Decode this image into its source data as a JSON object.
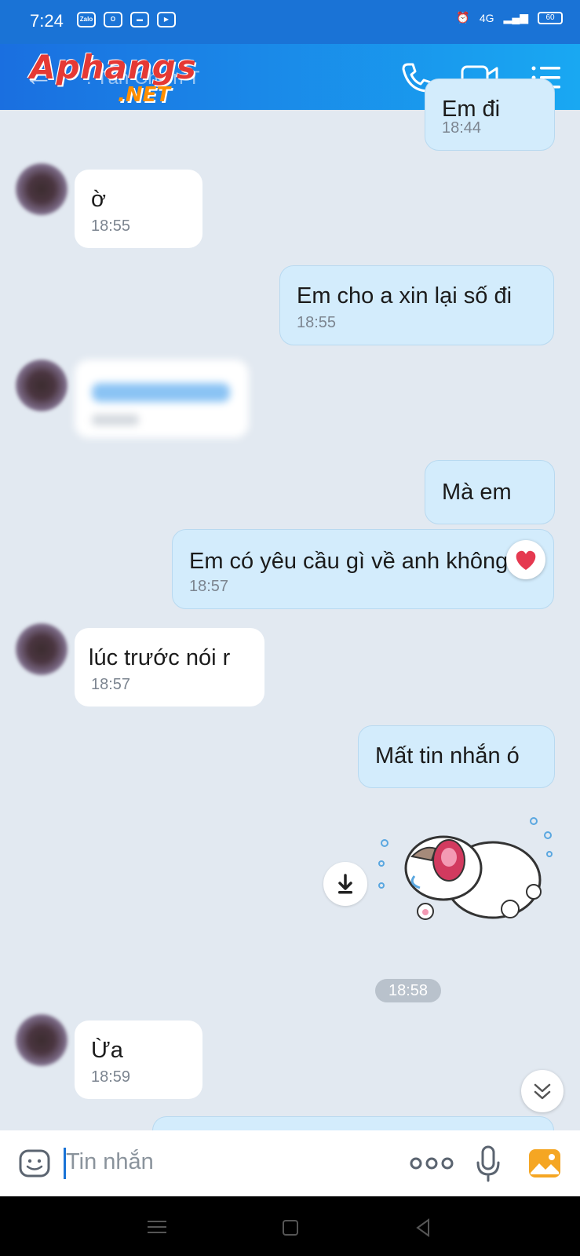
{
  "status_bar": {
    "time": "7:24",
    "app_icons": [
      "Zalo",
      "O",
      "▬",
      "▶"
    ],
    "network": "4G",
    "battery": "60"
  },
  "header": {
    "contact_name": ". Tấn Chiến T",
    "watermark": "Aphangs",
    "watermark_suffix": ".NET"
  },
  "messages": [
    {
      "side": "mine",
      "text": "Em đi",
      "time": "18:44"
    },
    {
      "side": "theirs",
      "text": "ờ",
      "time": "18:55"
    },
    {
      "side": "mine",
      "text": "Em cho a xin lại số đi",
      "time": "18:55"
    },
    {
      "side": "theirs",
      "text": "",
      "time": "",
      "blurred": true
    },
    {
      "side": "mine",
      "text": "Mà em",
      "time": ""
    },
    {
      "side": "mine",
      "text": "Em có yêu cầu gì về anh không",
      "time": "18:57",
      "reaction": "heart-icon"
    },
    {
      "side": "theirs",
      "text": "lúc trước nói r",
      "time": "18:57"
    },
    {
      "side": "mine",
      "text": "Mất tin nhắn ó",
      "time": ""
    },
    {
      "side": "mine",
      "sticker": "crying-cat-sticker"
    }
  ],
  "date_separator": "18:58",
  "last_message": {
    "side": "theirs",
    "text": "Ừa",
    "time": "18:59"
  },
  "input": {
    "placeholder": "Tin nhắn"
  },
  "colors": {
    "header_start": "#1a6fe0",
    "header_end": "#19a8f2",
    "mine_bubble": "#d3ecfc",
    "theirs_bubble": "#ffffff",
    "chat_bg": "#e2e9f1"
  }
}
